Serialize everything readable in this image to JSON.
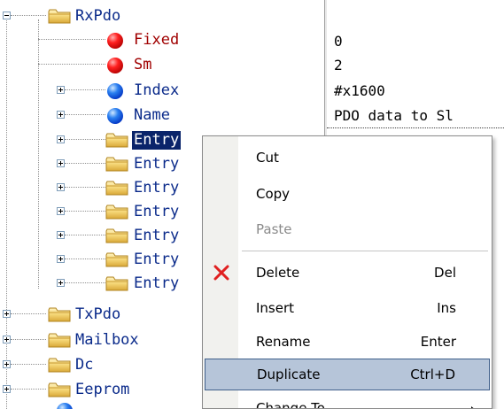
{
  "tree": {
    "rxpdo": "RxPdo",
    "fixed": "Fixed",
    "sm": "Sm",
    "index": "Index",
    "name": "Name",
    "entry1": "Entry",
    "entry2": "Entry",
    "entry3": "Entry",
    "entry4": "Entry",
    "entry5": "Entry",
    "entry6": "Entry",
    "entry7": "Entry",
    "txpdo": "TxPdo",
    "mailbox": "Mailbox",
    "dc": "Dc",
    "eeprom": "Eeprom"
  },
  "values": {
    "fixed": "0",
    "sm": "2",
    "index": "#x1600",
    "name": "PDO data to Sl"
  },
  "menu": {
    "cut": "Cut",
    "copy": "Copy",
    "paste": "Paste",
    "delete": "Delete",
    "delete_shortcut": "Del",
    "insert": "Insert",
    "insert_shortcut": "Ins",
    "rename": "Rename",
    "rename_shortcut": "Enter",
    "duplicate": "Duplicate",
    "duplicate_shortcut": "Ctrl+D",
    "change_to": "Change To"
  },
  "icons": {
    "folder": "folder-icon",
    "red_bullet": "red-bullet-icon",
    "blue_bullet": "blue-bullet-icon",
    "delete": "delete-x-icon",
    "submenu": "submenu-arrow-icon"
  },
  "colors": {
    "selection": "#0a246a",
    "menu_highlight": "#b6c5d9",
    "attr_text": "#a00000",
    "node_text": "#0a2a8a"
  }
}
